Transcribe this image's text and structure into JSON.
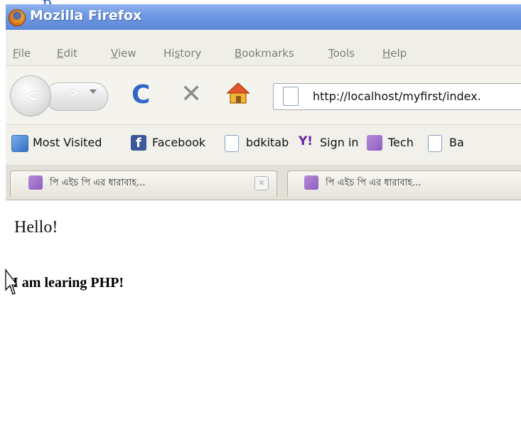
{
  "top_strip": {
    "text": "p"
  },
  "window": {
    "title": "Mozilla Firefox"
  },
  "menu": {
    "items": [
      {
        "key": "F",
        "rest": "ile"
      },
      {
        "key": "E",
        "rest": "dit"
      },
      {
        "key": "V",
        "rest": "iew"
      },
      {
        "pre": "Hi",
        "key": "s",
        "rest": "tory"
      },
      {
        "key": "B",
        "rest": "ookmarks"
      },
      {
        "key": "T",
        "rest": "ools"
      },
      {
        "key": "H",
        "rest": "elp"
      }
    ]
  },
  "navigation": {
    "back_icon": "back-arrow-icon",
    "forward_icon": "forward-arrow-icon",
    "reload_icon": "reload-icon",
    "stop_icon": "stop-icon",
    "home_icon": "home-icon",
    "url": "http://localhost/myfirst/index."
  },
  "bookmarks": {
    "items": [
      {
        "label": "Most Visited",
        "icon": "most-visited-icon"
      },
      {
        "label": "Facebook",
        "icon": "facebook-icon"
      },
      {
        "label": "bdkitab",
        "icon": "page-icon"
      },
      {
        "label": "Sign in",
        "icon": "yahoo-icon"
      },
      {
        "label": "Tech",
        "icon": "tech-icon"
      },
      {
        "label": "Ba",
        "icon": "page-icon"
      }
    ]
  },
  "tabs": [
    {
      "label": "পি এইচ পি এর ধারাবাহ..."
    },
    {
      "label": "পি এইচ পি এর ধারাবাহ..."
    }
  ],
  "page": {
    "greeting": "Hello!",
    "message": "I am learing PHP!"
  },
  "colors": {
    "titlebar": "#6d97e2",
    "link_blue": "#1f59c6",
    "reload_blue": "#2f66c7",
    "facebook_blue": "#3b5998",
    "yahoo_purple": "#6b1ea5"
  }
}
